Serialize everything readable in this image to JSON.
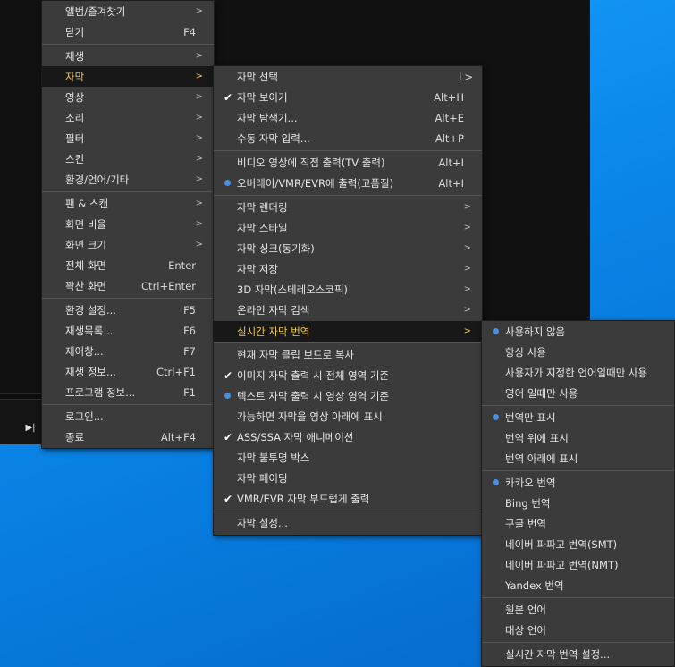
{
  "main_menu": {
    "items": [
      {
        "label": "앨범/즐겨찾기",
        "shortcut": "",
        "arrow": ">"
      },
      {
        "label": "닫기",
        "shortcut": "F4",
        "arrow": ""
      },
      {
        "label": "재생",
        "shortcut": "",
        "arrow": ">"
      },
      {
        "label": "자막",
        "shortcut": "",
        "arrow": ">"
      },
      {
        "label": "영상",
        "shortcut": "",
        "arrow": ">"
      },
      {
        "label": "소리",
        "shortcut": "",
        "arrow": ">"
      },
      {
        "label": "필터",
        "shortcut": "",
        "arrow": ">"
      },
      {
        "label": "스킨",
        "shortcut": "",
        "arrow": ">"
      },
      {
        "label": "환경/언어/기타",
        "shortcut": "",
        "arrow": ">"
      },
      {
        "label": "팬 & 스캔",
        "shortcut": "",
        "arrow": ">"
      },
      {
        "label": "화면 비율",
        "shortcut": "",
        "arrow": ">"
      },
      {
        "label": "화면 크기",
        "shortcut": "",
        "arrow": ">"
      },
      {
        "label": "전체 화면",
        "shortcut": "Enter",
        "arrow": ""
      },
      {
        "label": "꽉찬 화면",
        "shortcut": "Ctrl+Enter",
        "arrow": ""
      },
      {
        "label": "환경 설정...",
        "shortcut": "F5",
        "arrow": ""
      },
      {
        "label": "재생목록...",
        "shortcut": "F6",
        "arrow": ""
      },
      {
        "label": "제어창...",
        "shortcut": "F7",
        "arrow": ""
      },
      {
        "label": "재생 정보...",
        "shortcut": "Ctrl+F1",
        "arrow": ""
      },
      {
        "label": "프로그램 정보...",
        "shortcut": "F1",
        "arrow": ""
      },
      {
        "label": "로그인...",
        "shortcut": "",
        "arrow": ""
      },
      {
        "label": "종료",
        "shortcut": "Alt+F4",
        "arrow": ""
      }
    ]
  },
  "subtitle_menu": {
    "items": [
      {
        "label": "자막 선택",
        "shortcut": "L>",
        "arrow": ""
      },
      {
        "label": "자막 보이기",
        "shortcut": "Alt+H",
        "arrow": ""
      },
      {
        "label": "자막 탐색기...",
        "shortcut": "Alt+E",
        "arrow": ""
      },
      {
        "label": "수동 자막 입력...",
        "shortcut": "Alt+P",
        "arrow": ""
      },
      {
        "label": "비디오 영상에 직접 출력(TV 출력)",
        "shortcut": "Alt+I",
        "arrow": ""
      },
      {
        "label": "오버레이/VMR/EVR에 출력(고품질)",
        "shortcut": "Alt+I",
        "arrow": ""
      },
      {
        "label": "자막 렌더링",
        "shortcut": "",
        "arrow": ">"
      },
      {
        "label": "자막 스타일",
        "shortcut": "",
        "arrow": ">"
      },
      {
        "label": "자막 싱크(동기화)",
        "shortcut": "",
        "arrow": ">"
      },
      {
        "label": "자막 저장",
        "shortcut": "",
        "arrow": ">"
      },
      {
        "label": "3D 자막(스테레오스코픽)",
        "shortcut": "",
        "arrow": ">"
      },
      {
        "label": "온라인 자막 검색",
        "shortcut": "",
        "arrow": ">"
      },
      {
        "label": "실시간 자막 번역",
        "shortcut": "",
        "arrow": ">"
      },
      {
        "label": "현재 자막 클립 보드로 복사",
        "shortcut": "",
        "arrow": ""
      },
      {
        "label": "이미지 자막 출력 시 전체 영역 기준",
        "shortcut": "",
        "arrow": ""
      },
      {
        "label": "텍스트 자막 출력 시 영상 영역 기준",
        "shortcut": "",
        "arrow": ""
      },
      {
        "label": "가능하면 자막을 영상 아래에 표시",
        "shortcut": "",
        "arrow": ""
      },
      {
        "label": "ASS/SSA 자막 애니메이션",
        "shortcut": "",
        "arrow": ""
      },
      {
        "label": "자막 불투명 박스",
        "shortcut": "",
        "arrow": ""
      },
      {
        "label": "자막 페이딩",
        "shortcut": "",
        "arrow": ""
      },
      {
        "label": "VMR/EVR 자막 부드럽게 출력",
        "shortcut": "",
        "arrow": ""
      },
      {
        "label": "자막 설정...",
        "shortcut": "",
        "arrow": ""
      }
    ]
  },
  "translate_menu": {
    "items": [
      {
        "label": "사용하지 않음"
      },
      {
        "label": "항상 사용"
      },
      {
        "label": "사용자가 지정한 언어일때만 사용"
      },
      {
        "label": "영어 일때만 사용"
      },
      {
        "label": "번역만 표시"
      },
      {
        "label": "번역 위에 표시"
      },
      {
        "label": "번역 아래에 표시"
      },
      {
        "label": "카카오 번역"
      },
      {
        "label": "Bing 번역"
      },
      {
        "label": "구글 번역"
      },
      {
        "label": "네이버 파파고 번역(SMT)"
      },
      {
        "label": "네이버 파파고 번역(NMT)"
      },
      {
        "label": "Yandex 번역"
      },
      {
        "label": "원본 언어"
      },
      {
        "label": "대상 언어"
      },
      {
        "label": "실시간 자막 번역 설정..."
      }
    ]
  },
  "colors": {
    "highlight_text": "#f2c94c",
    "radio_dot": "#4a90e2",
    "menu_bg": "#3b3b3b"
  }
}
